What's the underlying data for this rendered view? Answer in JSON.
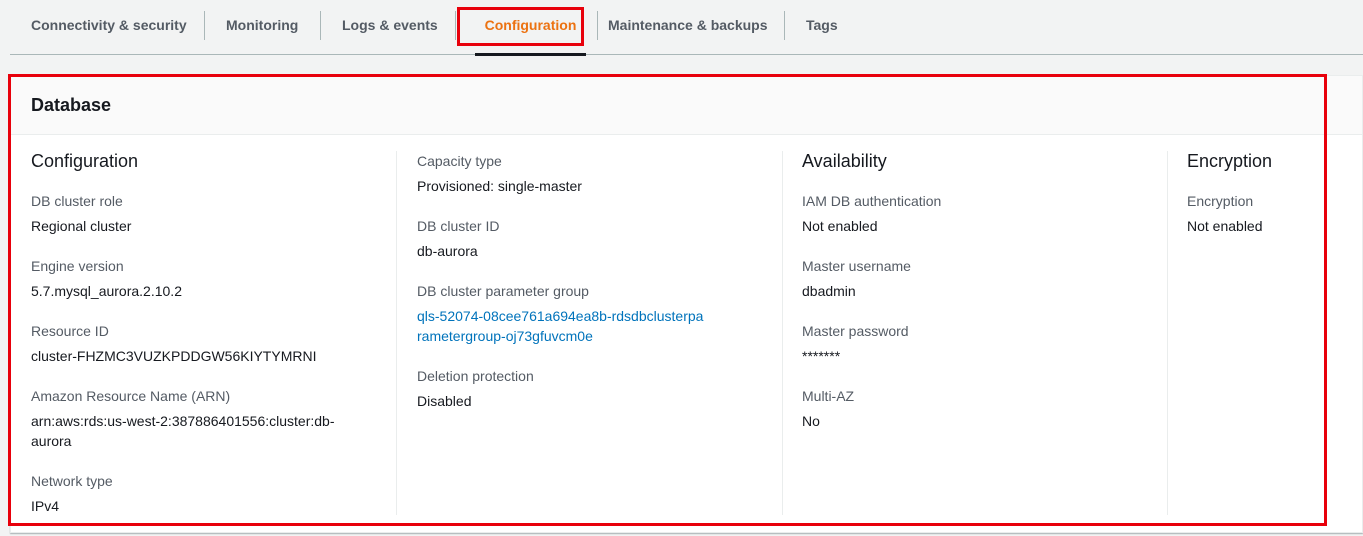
{
  "tabs": [
    {
      "label": "Connectivity & security"
    },
    {
      "label": "Monitoring"
    },
    {
      "label": "Logs & events"
    },
    {
      "label": "Configuration"
    },
    {
      "label": "Maintenance & backups"
    },
    {
      "label": "Tags"
    }
  ],
  "active_tab": "Configuration",
  "panel": {
    "title": "Database",
    "configuration": {
      "heading": "Configuration",
      "db_cluster_role": {
        "label": "DB cluster role",
        "value": "Regional cluster"
      },
      "engine_version": {
        "label": "Engine version",
        "value": "5.7.mysql_aurora.2.10.2"
      },
      "resource_id": {
        "label": "Resource ID",
        "value": "cluster-FHZMC3VUZKPDDGW56KIYTYMRNI"
      },
      "arn": {
        "label": "Amazon Resource Name (ARN)",
        "value": "arn:aws:rds:us-west-2:387886401556:cluster:db-aurora"
      },
      "network_type": {
        "label": "Network type",
        "value": "IPv4"
      }
    },
    "cluster": {
      "capacity_type": {
        "label": "Capacity type",
        "value": "Provisioned: single-master"
      },
      "db_cluster_id": {
        "label": "DB cluster ID",
        "value": "db-aurora"
      },
      "parameter_group": {
        "label": "DB cluster parameter group",
        "value": "qls-52074-08cee761a694ea8b-rdsdbclusterparametergroup-oj73gfuvcm0e"
      },
      "deletion_protection": {
        "label": "Deletion protection",
        "value": "Disabled"
      }
    },
    "availability": {
      "heading": "Availability",
      "iam_auth": {
        "label": "IAM DB authentication",
        "value": "Not enabled"
      },
      "master_username": {
        "label": "Master username",
        "value": "dbadmin"
      },
      "master_password": {
        "label": "Master password",
        "value": "*******"
      },
      "multi_az": {
        "label": "Multi-AZ",
        "value": "No"
      }
    },
    "encryption": {
      "heading": "Encryption",
      "encryption": {
        "label": "Encryption",
        "value": "Not enabled"
      }
    }
  },
  "colors": {
    "accent": "#ec7211",
    "link": "#0073bb",
    "highlight": "#e8000b"
  }
}
